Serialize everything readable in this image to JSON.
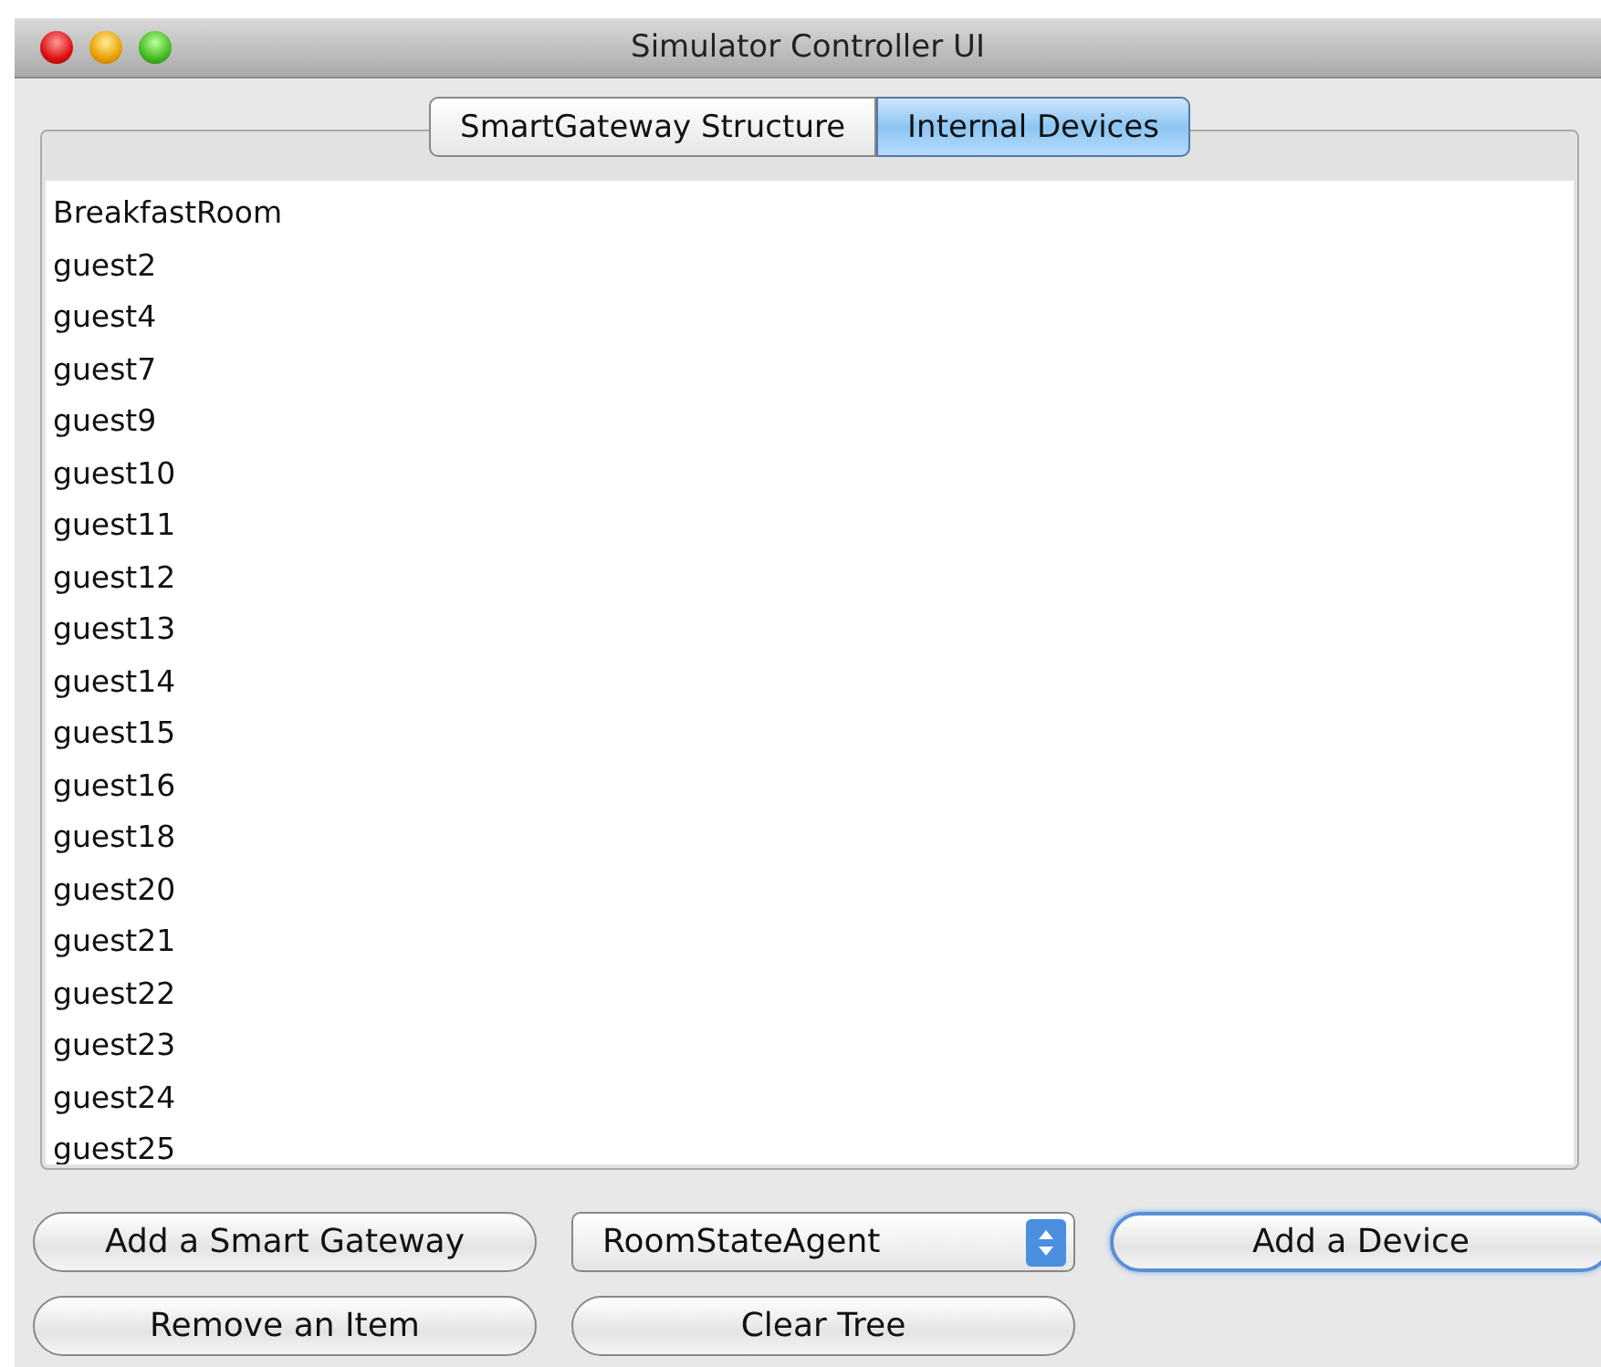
{
  "window": {
    "title": "Simulator Controller UI"
  },
  "tabs": [
    {
      "label": "SmartGateway Structure",
      "selected": false
    },
    {
      "label": "Internal Devices",
      "selected": true
    }
  ],
  "list": {
    "items": [
      "BreakfastRoom",
      "guest2",
      "guest4",
      "guest7",
      "guest9",
      "guest10",
      "guest11",
      "guest12",
      "guest13",
      "guest14",
      "guest15",
      "guest16",
      "guest18",
      "guest20",
      "guest21",
      "guest22",
      "guest23",
      "guest24",
      "guest25"
    ]
  },
  "controls": [
    {
      "kind": "button",
      "label": "Add a Smart Gateway",
      "focused": false
    },
    {
      "kind": "select",
      "value": "RoomStateAgent"
    },
    {
      "kind": "button",
      "label": "Add a Device",
      "focused": true
    },
    {
      "kind": "button",
      "label": "Remove an Item",
      "focused": false
    },
    {
      "kind": "button",
      "label": "Clear Tree",
      "focused": false
    }
  ]
}
